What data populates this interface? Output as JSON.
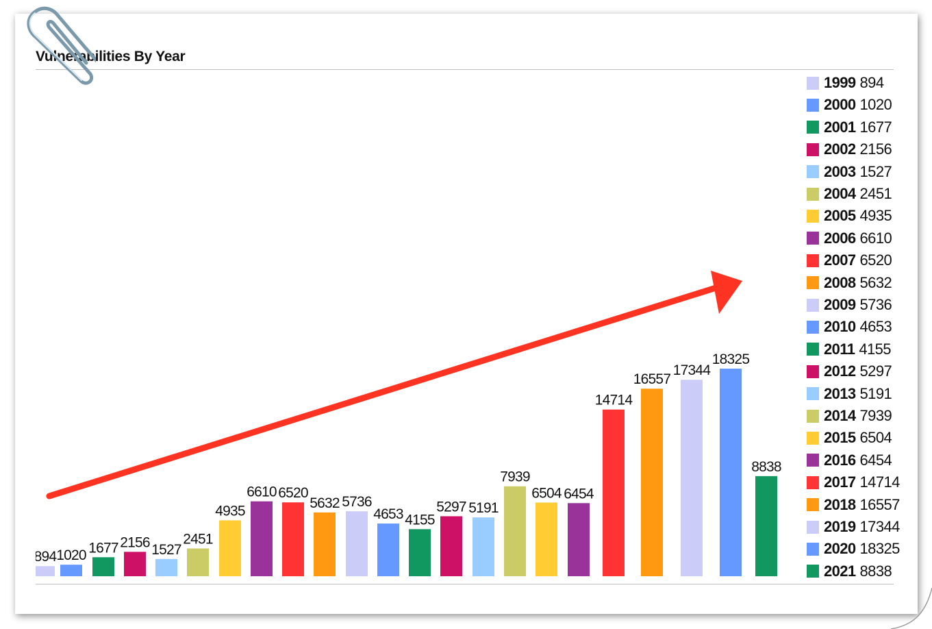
{
  "chart_data": {
    "type": "bar",
    "title": "Vulnerabilities By Year",
    "categories": [
      "1999",
      "2000",
      "2001",
      "2002",
      "2003",
      "2004",
      "2005",
      "2006",
      "2007",
      "2008",
      "2009",
      "2010",
      "2011",
      "2012",
      "2013",
      "2014",
      "2015",
      "2016",
      "2017",
      "2018",
      "2019",
      "2020",
      "2021"
    ],
    "values": [
      894,
      1020,
      1677,
      2156,
      1527,
      2451,
      4935,
      6610,
      6520,
      5632,
      5736,
      4653,
      4155,
      5297,
      5191,
      7939,
      6504,
      6454,
      14714,
      16557,
      17344,
      18325,
      8838
    ],
    "colors": [
      "#ccccf8",
      "#6699ff",
      "#109860",
      "#cc1166",
      "#99ccff",
      "#cccc66",
      "#ffcc33",
      "#993399",
      "#ff3333",
      "#ff9911",
      "#ccccf8",
      "#6699ff",
      "#109860",
      "#cc1166",
      "#99ccff",
      "#cccc66",
      "#ffcc33",
      "#993399",
      "#ff3333",
      "#ff9911",
      "#ccccf8",
      "#6699ff",
      "#109860"
    ],
    "ylim": [
      0,
      18325
    ],
    "legend_position": "right",
    "data_labels": true,
    "annotations": [
      {
        "type": "arrow",
        "color": "#ff3322",
        "direction": "up-right trend"
      }
    ]
  },
  "icons": [
    "paperclip-icon"
  ]
}
